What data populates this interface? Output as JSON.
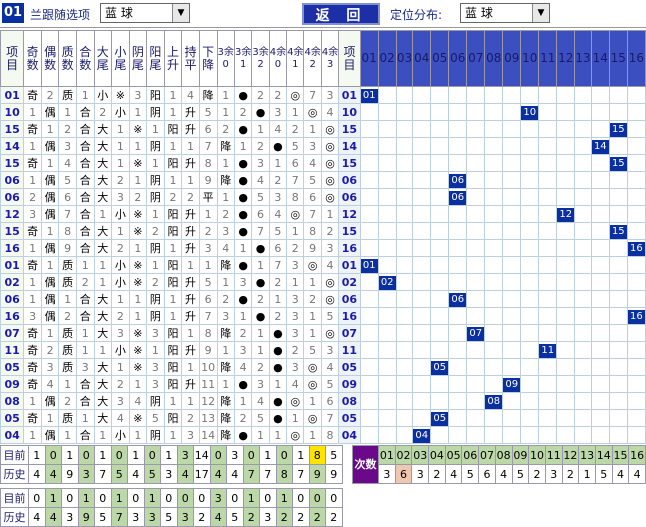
{
  "toolbar": {
    "badge": "01",
    "option_label": "兰跟随选项",
    "select1": "蓝   球",
    "back_label": "返 回",
    "pos_label": "定位分布:",
    "select2": "蓝   球"
  },
  "headers": [
    "项目",
    "奇数",
    "偶数",
    "质数",
    "合数",
    "大尾",
    "小尾",
    "阴尾",
    "阳尾",
    "上升",
    "持平",
    "下降",
    "3余0",
    "3余1",
    "3余2",
    "4余0",
    "4余1",
    "4余2",
    "4余3",
    "项目"
  ],
  "pos_headers": [
    "01",
    "02",
    "03",
    "04",
    "05",
    "06",
    "07",
    "08",
    "09",
    "10",
    "11",
    "12",
    "13",
    "14",
    "15",
    "16"
  ],
  "rows": [
    {
      "v": "01",
      "c": [
        "奇",
        "2",
        "质",
        "1",
        "小",
        "※",
        "3",
        "阳",
        "1",
        "4",
        "降",
        "1",
        "●",
        "2",
        "2",
        "◎",
        "7",
        "3"
      ]
    },
    {
      "v": "10",
      "c": [
        "1",
        "偶",
        "1",
        "合",
        "2",
        "小",
        "1",
        "阴",
        "1",
        "升",
        "5",
        "1",
        "2",
        "●",
        "3",
        "1",
        "◎",
        "4"
      ]
    },
    {
      "v": "15",
      "c": [
        "奇",
        "1",
        "2",
        "合",
        "大",
        "1",
        "※",
        "1",
        "阳",
        "升",
        "6",
        "2",
        "●",
        "1",
        "4",
        "2",
        "1",
        "◎"
      ]
    },
    {
      "v": "14",
      "c": [
        "1",
        "偶",
        "3",
        "合",
        "大",
        "1",
        "1",
        "阴",
        "1",
        "1",
        "7",
        "降",
        "1",
        "2",
        "●",
        "5",
        "3",
        "◎"
      ]
    },
    {
      "v": "15",
      "c": [
        "奇",
        "1",
        "4",
        "合",
        "大",
        "1",
        "※",
        "1",
        "阳",
        "升",
        "8",
        "1",
        "●",
        "3",
        "1",
        "6",
        "4",
        "◎"
      ]
    },
    {
      "v": "06",
      "c": [
        "1",
        "偶",
        "5",
        "合",
        "大",
        "2",
        "1",
        "阴",
        "1",
        "1",
        "9",
        "降",
        "●",
        "4",
        "2",
        "7",
        "5",
        "◎"
      ]
    },
    {
      "v": "06",
      "c": [
        "2",
        "偶",
        "6",
        "合",
        "大",
        "3",
        "2",
        "阴",
        "2",
        "2",
        "平",
        "1",
        "●",
        "5",
        "3",
        "8",
        "6",
        "◎"
      ]
    },
    {
      "v": "12",
      "c": [
        "3",
        "偶",
        "7",
        "合",
        "1",
        "小",
        "※",
        "1",
        "阳",
        "升",
        "1",
        "2",
        "●",
        "6",
        "4",
        "◎",
        "7",
        "1"
      ]
    },
    {
      "v": "15",
      "c": [
        "奇",
        "1",
        "8",
        "合",
        "大",
        "1",
        "※",
        "2",
        "阳",
        "升",
        "2",
        "3",
        "●",
        "7",
        "5",
        "1",
        "8",
        "2"
      ]
    },
    {
      "v": "16",
      "c": [
        "1",
        "偶",
        "9",
        "合",
        "大",
        "2",
        "1",
        "阴",
        "1",
        "升",
        "3",
        "4",
        "1",
        "●",
        "6",
        "2",
        "9",
        "3"
      ]
    },
    {
      "v": "01",
      "c": [
        "奇",
        "1",
        "质",
        "1",
        "1",
        "小",
        "※",
        "1",
        "阳",
        "1",
        "1",
        "降",
        "●",
        "1",
        "7",
        "3",
        "◎",
        "4"
      ]
    },
    {
      "v": "02",
      "c": [
        "1",
        "偶",
        "质",
        "2",
        "1",
        "小",
        "※",
        "2",
        "阳",
        "升",
        "5",
        "1",
        "3",
        "●",
        "2",
        "1",
        "1",
        "◎"
      ]
    },
    {
      "v": "06",
      "c": [
        "1",
        "偶",
        "1",
        "合",
        "大",
        "1",
        "1",
        "阴",
        "1",
        "升",
        "6",
        "2",
        "●",
        "2",
        "1",
        "3",
        "2",
        "◎"
      ]
    },
    {
      "v": "16",
      "c": [
        "3",
        "偶",
        "2",
        "合",
        "大",
        "2",
        "1",
        "阴",
        "1",
        "升",
        "7",
        "3",
        "1",
        "●",
        "2",
        "3",
        "1",
        "5"
      ]
    },
    {
      "v": "07",
      "c": [
        "奇",
        "1",
        "质",
        "1",
        "大",
        "3",
        "※",
        "3",
        "阳",
        "1",
        "8",
        "降",
        "2",
        "1",
        "●",
        "3",
        "1",
        "◎"
      ]
    },
    {
      "v": "11",
      "c": [
        "奇",
        "2",
        "质",
        "1",
        "1",
        "小",
        "※",
        "1",
        "阳",
        "升",
        "9",
        "1",
        "3",
        "1",
        "●",
        "2",
        "5",
        "3"
      ]
    },
    {
      "v": "05",
      "c": [
        "奇",
        "3",
        "质",
        "3",
        "大",
        "1",
        "※",
        "3",
        "阳",
        "1",
        "10",
        "降",
        "4",
        "2",
        "●",
        "3",
        "◎",
        "4"
      ]
    },
    {
      "v": "09",
      "c": [
        "奇",
        "4",
        "1",
        "合",
        "大",
        "2",
        "1",
        "3",
        "阳",
        "升",
        "11",
        "1",
        "●",
        "3",
        "1",
        "4",
        "◎",
        "5"
      ]
    },
    {
      "v": "08",
      "c": [
        "1",
        "偶",
        "2",
        "合",
        "大",
        "3",
        "4",
        "阴",
        "1",
        "1",
        "12",
        "降",
        "1",
        "4",
        "●",
        "◎",
        "1",
        "6"
      ]
    },
    {
      "v": "05",
      "c": [
        "奇",
        "1",
        "质",
        "1",
        "大",
        "4",
        "※",
        "5",
        "阳",
        "2",
        "13",
        "降",
        "2",
        "5",
        "●",
        "1",
        "◎",
        "7"
      ]
    },
    {
      "v": "04",
      "c": [
        "1",
        "偶",
        "1",
        "合",
        "1",
        "小",
        "1",
        "阴",
        "1",
        "3",
        "14",
        "降",
        "●",
        "1",
        "1",
        "◎",
        "1",
        "8"
      ]
    }
  ],
  "summary_left": {
    "current_label": "目前",
    "history_label": "历史",
    "current": [
      "1",
      "0",
      "1",
      "0",
      "1",
      "0",
      "1",
      "0",
      "1",
      "3",
      "14",
      "0",
      "3",
      "0",
      "1",
      "0",
      "1",
      "8",
      "5"
    ],
    "history": [
      "4",
      "4",
      "9",
      "3",
      "7",
      "5",
      "4",
      "5",
      "3",
      "4",
      "17",
      "4",
      "4",
      "7",
      "7",
      "8",
      "7",
      "9",
      "9"
    ]
  },
  "summary_right": {
    "label": "次数",
    "nums": [
      "01",
      "02",
      "03",
      "04",
      "05",
      "06",
      "07",
      "08",
      "09",
      "10",
      "11",
      "12",
      "13",
      "14",
      "15",
      "16"
    ],
    "counts": [
      "3",
      "6",
      "3",
      "2",
      "4",
      "5",
      "6",
      "4",
      "5",
      "2",
      "3",
      "2",
      "1",
      "5",
      "4",
      "4"
    ]
  },
  "bottom": {
    "current_label": "目前",
    "history_label": "历史",
    "current": [
      "0",
      "1",
      "0",
      "1",
      "0",
      "1",
      "0",
      "1",
      "0",
      "0",
      "0",
      "3",
      "0",
      "1",
      "0",
      "1",
      "0",
      "0",
      "0"
    ],
    "history": [
      "4",
      "4",
      "3",
      "9",
      "5",
      "7",
      "3",
      "3",
      "5",
      "3",
      "2",
      "4",
      "5",
      "2",
      "3",
      "2",
      "2",
      "2",
      "2"
    ]
  },
  "colors": {
    "box": "#0a2fa0",
    "separator": "#c03030",
    "highlight": "#ffe400"
  }
}
